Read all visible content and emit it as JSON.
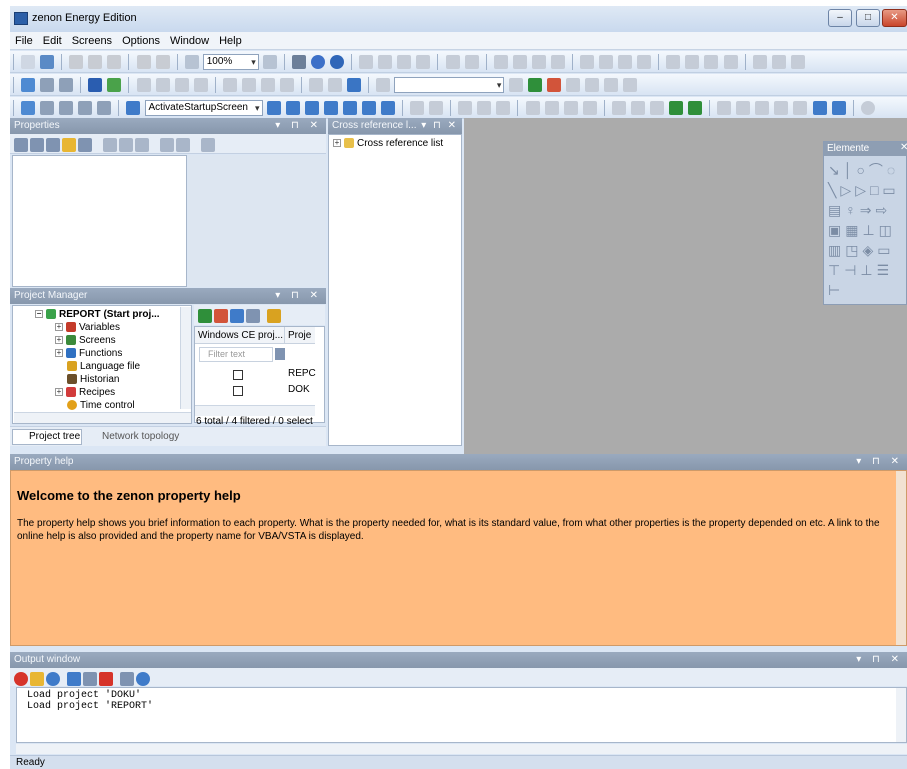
{
  "window": {
    "title": "zenon Energy Edition",
    "controls": [
      "minimize",
      "maximize",
      "close"
    ]
  },
  "menu": [
    "File",
    "Edit",
    "Screens",
    "Options",
    "Window",
    "Help"
  ],
  "toolbar1": {
    "zoom": "100%"
  },
  "toolbar3": {
    "startup_combo": "ActivateStartupScreen"
  },
  "properties": {
    "title": "Properties"
  },
  "crossref": {
    "title": "Cross reference l...",
    "item": "Cross reference list"
  },
  "elemente": {
    "title": "Elemente"
  },
  "project_manager": {
    "title": "Project Manager",
    "root": "REPORT (Start proj...",
    "items": [
      "Variables",
      "Screens",
      "Functions",
      "Language file",
      "Historian",
      "Recipes",
      "Time control"
    ],
    "grid": {
      "col1": "Windows CE proj...",
      "col2": "Proje",
      "filter_placeholder": "Filter text",
      "rows": [
        "REPC",
        "DOK"
      ],
      "summary": "6 total / 4 filtered / 0 select"
    },
    "tabs": [
      "Project tree",
      "Network topology"
    ]
  },
  "property_help": {
    "title": "Property help",
    "heading": "Welcome to the zenon property help",
    "body": "The property help shows you brief information to each property. What is the property needed for, what is its standard value, from what other properties is the property depended on etc. A link to the online help is also provided and the property name for VBA/VSTA is displayed."
  },
  "output": {
    "title": "Output window",
    "lines": [
      "Load project 'DOKU'",
      "Load project 'REPORT'"
    ]
  },
  "status": {
    "text": "Ready"
  },
  "colors": {
    "help_bg": "#ffbb80",
    "pane_header": "#8e9eb3",
    "workspace": "#ababab"
  }
}
